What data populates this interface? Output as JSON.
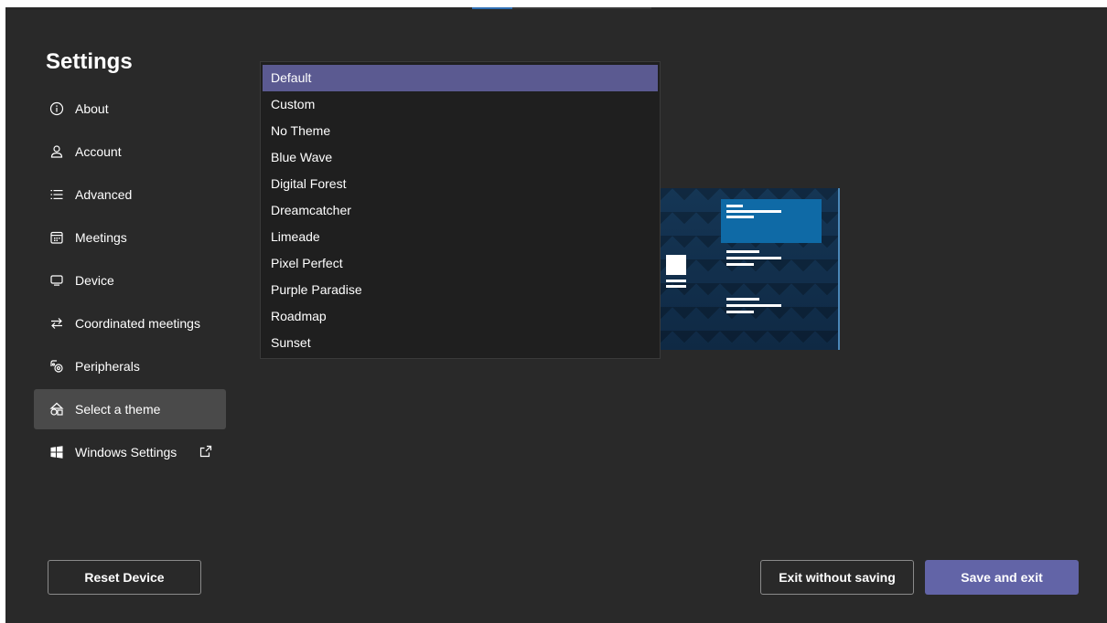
{
  "title": "Settings",
  "nav": {
    "items": [
      {
        "label": "About",
        "icon": "info-icon"
      },
      {
        "label": "Account",
        "icon": "person-icon"
      },
      {
        "label": "Advanced",
        "icon": "list-icon"
      },
      {
        "label": "Meetings",
        "icon": "calendar-icon"
      },
      {
        "label": "Device",
        "icon": "monitor-icon"
      },
      {
        "label": "Coordinated meetings",
        "icon": "swap-arrows-icon"
      },
      {
        "label": "Peripherals",
        "icon": "peripherals-icon"
      },
      {
        "label": "Select a theme",
        "icon": "shapes-icon",
        "selected": true
      },
      {
        "label": "Windows Settings",
        "icon": "windows-logo-icon",
        "external": "open-external-icon"
      }
    ]
  },
  "theme_dropdown": {
    "selected": "Default",
    "options": [
      "Default",
      "Custom",
      "No Theme",
      "Blue Wave",
      "Digital Forest",
      "Dreamcatcher",
      "Limeade",
      "Pixel Perfect",
      "Purple Paradise",
      "Roadmap",
      "Sunset"
    ]
  },
  "buttons": {
    "reset": "Reset Device",
    "exit_without_saving": "Exit without saving",
    "save_and_exit": "Save and exit"
  },
  "colors": {
    "background": "#292929",
    "selected_option": "#5b5a91",
    "primary_button": "#6264a7",
    "selected_nav": "#4a4a4a"
  }
}
